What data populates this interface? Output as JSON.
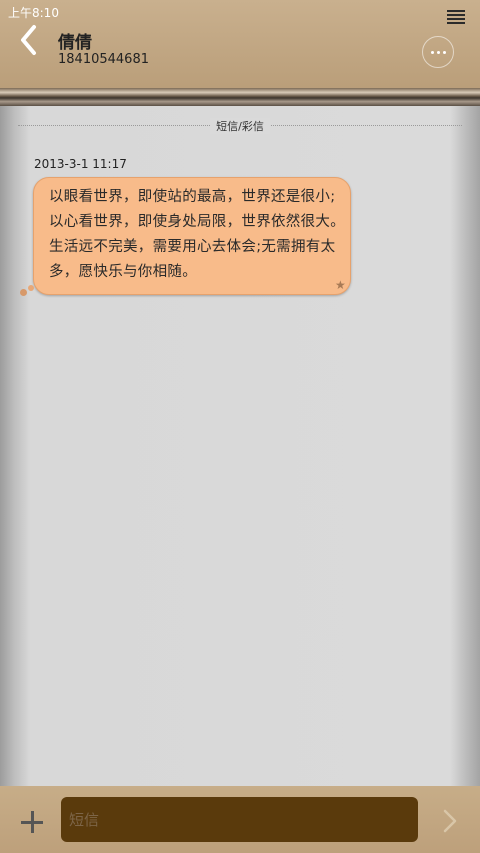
{
  "status_bar": {
    "time": "上午8:10"
  },
  "header": {
    "contact_name": "倩倩",
    "contact_number": "18410544681"
  },
  "thread": {
    "channel_label": "短信/彩信",
    "messages": [
      {
        "timestamp": "2013-3-1 11:17",
        "text": "以眼看世界，即使站的最高，世界还是很小;以心看世界，即使身处局限，世界依然很大。生活远不完美，需要用心去体会;无需拥有太多，愿快乐与你相随。"
      }
    ]
  },
  "composer": {
    "placeholder": "短信"
  },
  "colors": {
    "header_bg": "#c3a783",
    "bubble_bg": "#f8bb8a",
    "input_bg": "#5a3a0c",
    "thread_bg": "#dadada"
  },
  "icons": [
    "back-icon",
    "menu-icon",
    "more-icon",
    "star-icon",
    "add-icon",
    "send-icon"
  ]
}
